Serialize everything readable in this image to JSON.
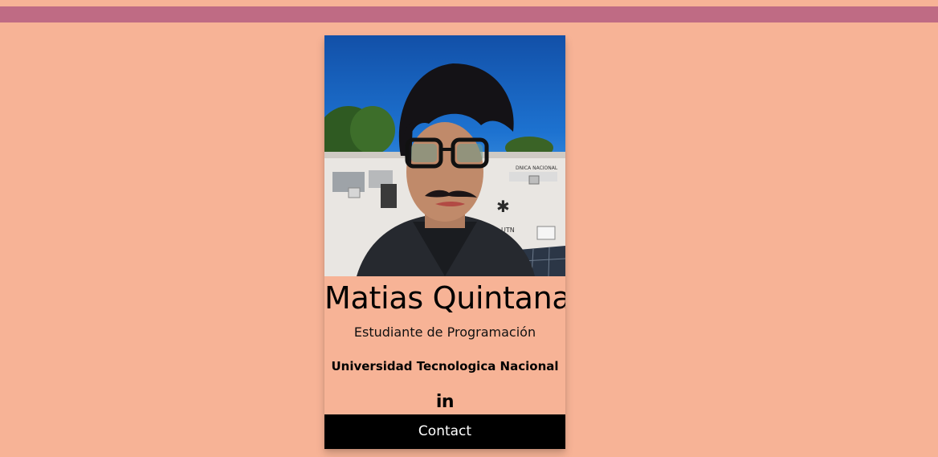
{
  "header": {
    "bar_color": "#bf6b84"
  },
  "colors": {
    "background": "#f7b396",
    "card": "#f7b396",
    "button_bg": "#000000",
    "button_text": "#ffffff"
  },
  "profile": {
    "photo_icon": "profile-photo",
    "name": "Matias Quintana",
    "role": "Estudiante de Programación",
    "school": "Universidad Tecnologica Nacional",
    "linkedin_icon": "linkedin-icon",
    "linkedin_label": "in"
  },
  "actions": {
    "contact_label": "Contact"
  }
}
